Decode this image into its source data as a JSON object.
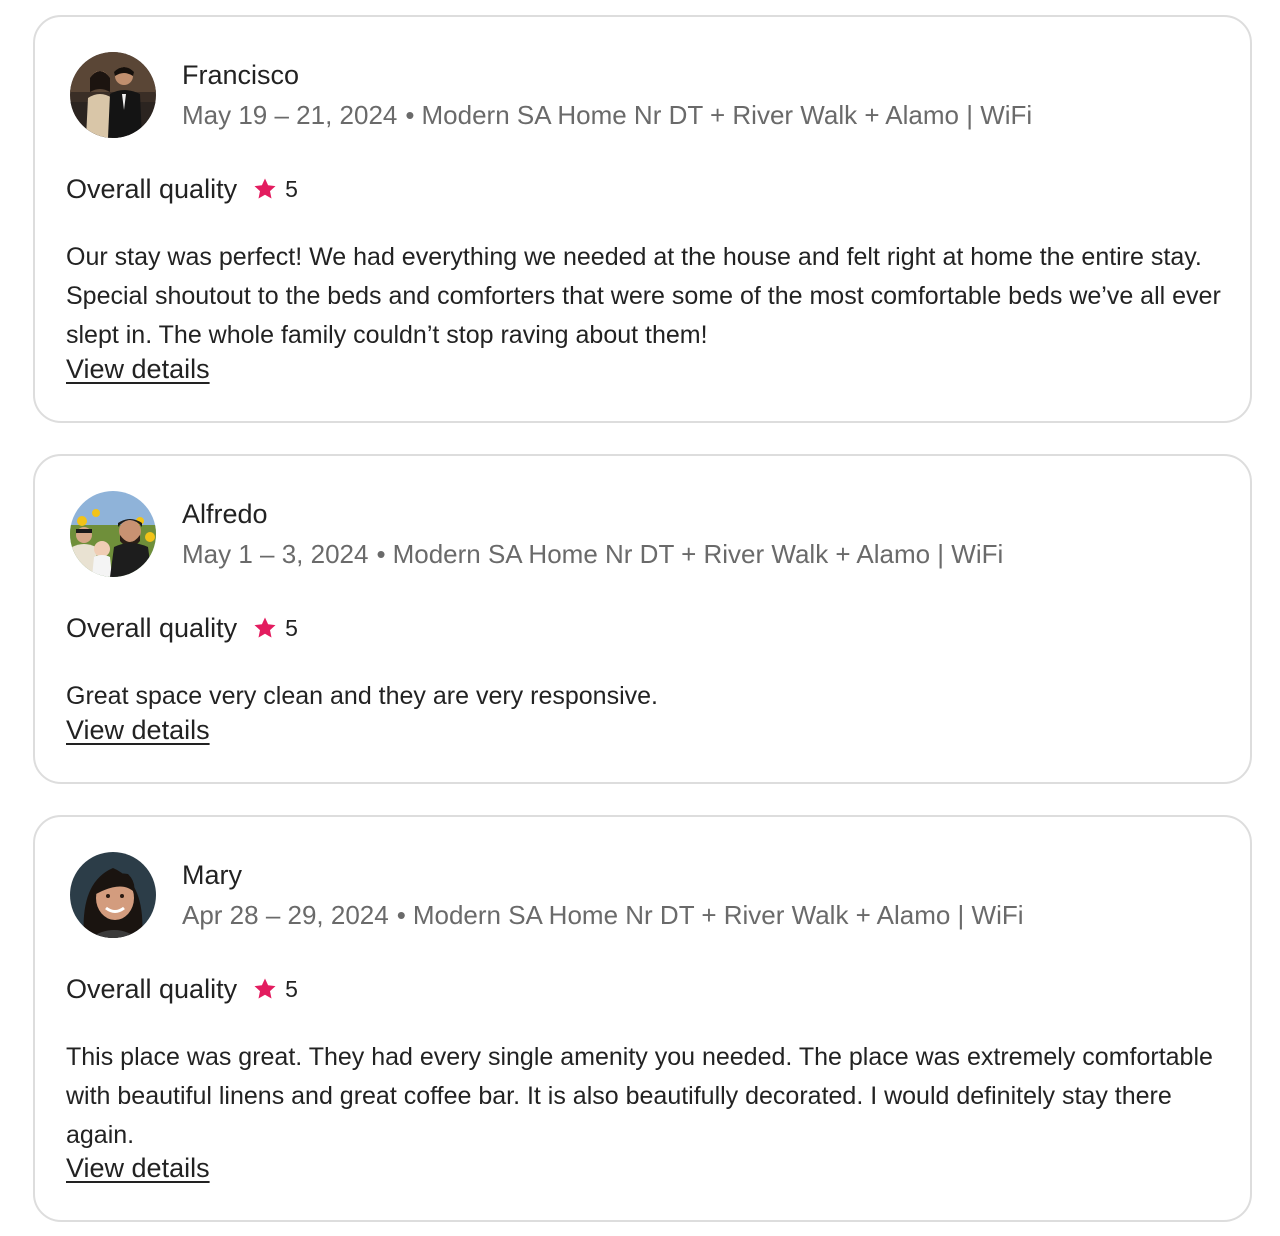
{
  "accent_color": "#e31c5f",
  "reviews": [
    {
      "name": "Francisco",
      "dates": "May 19 – 21, 2024",
      "separator": "•",
      "listing": "Modern SA Home Nr DT + River Walk + Alamo | WiFi",
      "rating_label": "Overall quality",
      "rating_icon": "star-icon",
      "rating": "5",
      "text": "Our stay was perfect! We had everything we needed at the house and felt right at home the entire stay. Special shoutout to the beds and comforters that were some of the most comfortable beds we’ve all ever slept in. The whole family couldn’t stop raving about them!",
      "link_label": "View details"
    },
    {
      "name": "Alfredo",
      "dates": "May 1 – 3, 2024",
      "separator": "•",
      "listing": "Modern SA Home Nr DT + River Walk + Alamo | WiFi",
      "rating_label": "Overall quality",
      "rating_icon": "star-icon",
      "rating": "5",
      "text": "Great space very clean and they are very responsive.",
      "link_label": "View details"
    },
    {
      "name": "Mary",
      "dates": "Apr 28 – 29, 2024",
      "separator": "•",
      "listing": "Modern SA Home Nr DT + River Walk + Alamo | WiFi",
      "rating_label": "Overall quality",
      "rating_icon": "star-icon",
      "rating": "5",
      "text": "This place was great. They had every single amenity you needed. The place was extremely comfortable with beautiful linens and great coffee bar. It is also beautifully decorated. I would definitely stay there again.",
      "link_label": "View details"
    }
  ]
}
